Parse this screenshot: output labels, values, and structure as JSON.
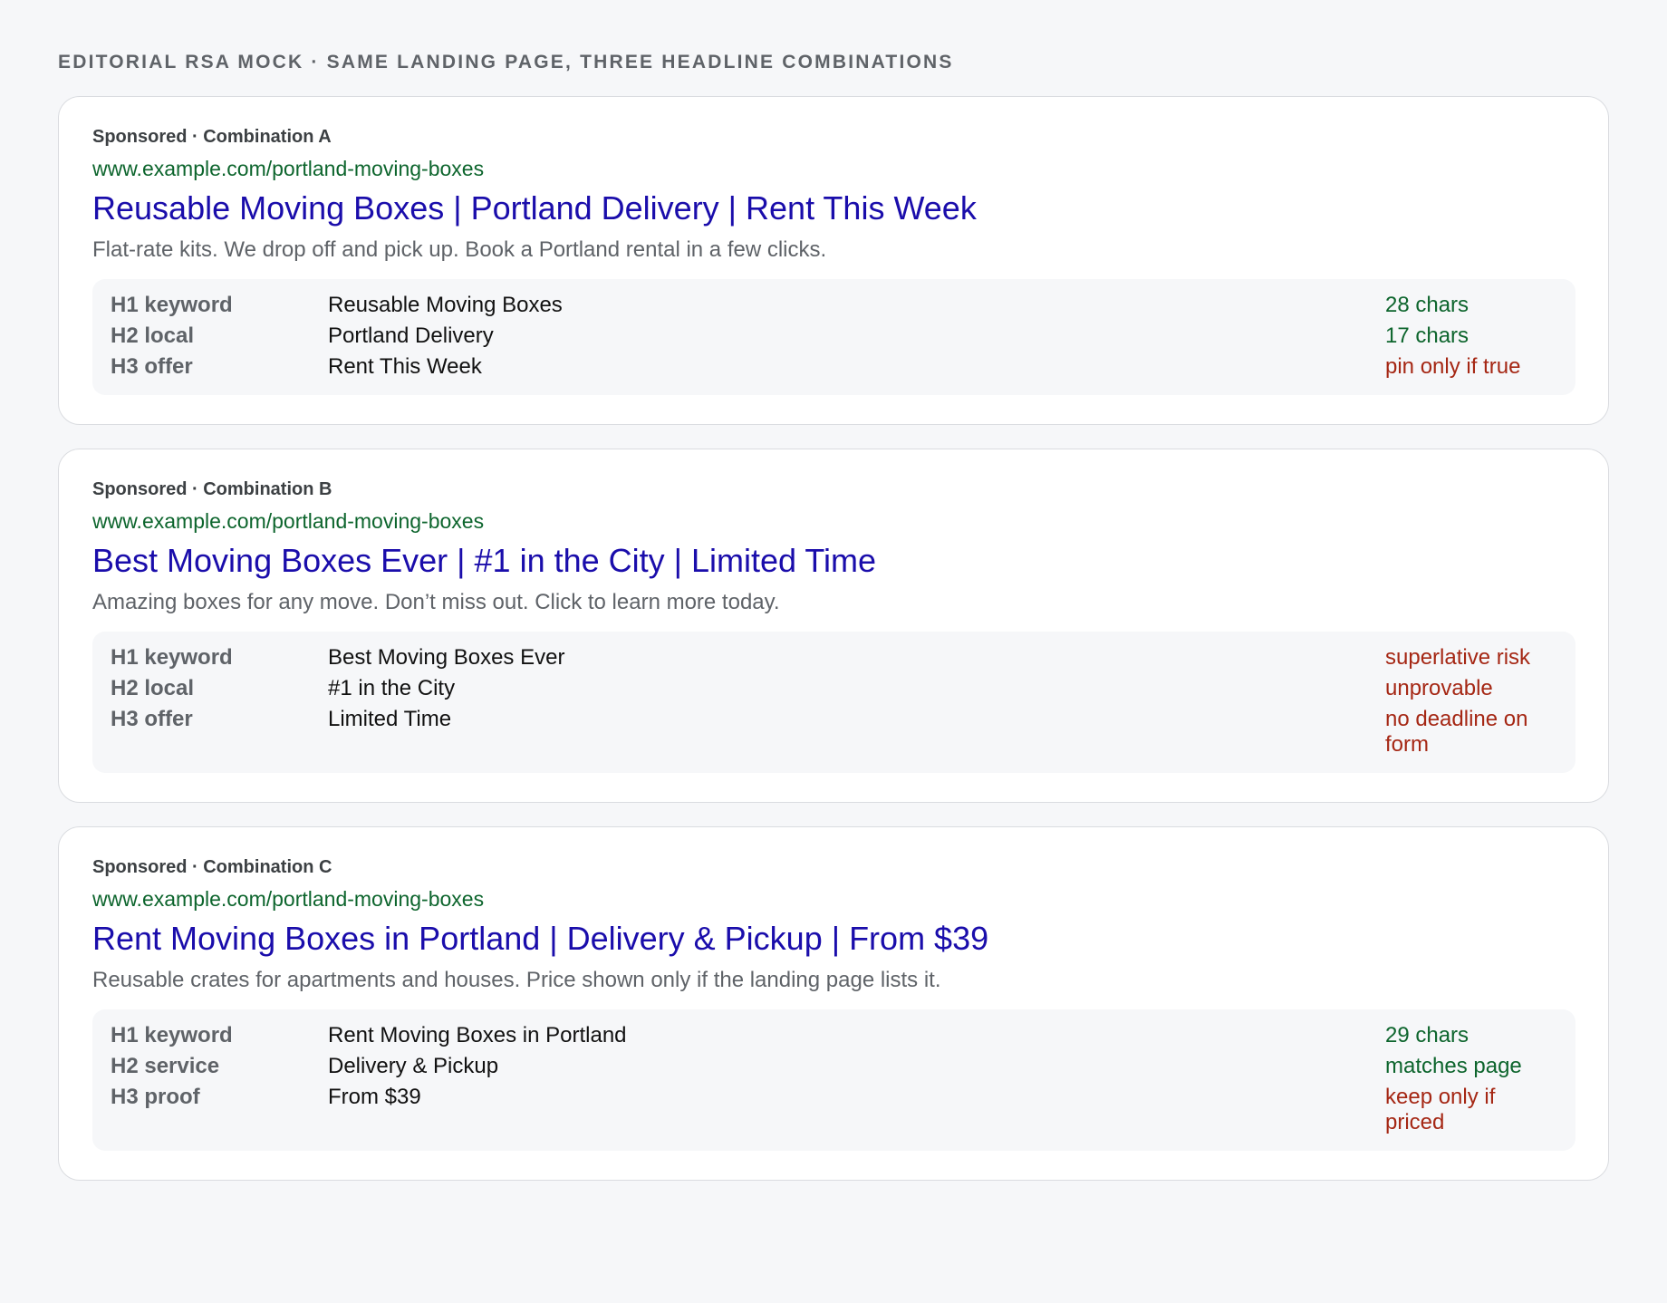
{
  "title": "EDITORIAL RSA MOCK · SAME LANDING PAGE, THREE HEADLINE COMBINATIONS",
  "colors": {
    "good": "#0d652d",
    "bad": "#a52714",
    "link": "#1a0dab",
    "url": "#0d652d"
  },
  "cards": [
    {
      "sponsored": "Sponsored · Combination A",
      "url": "www.example.com/portland-moving-boxes",
      "headline": "Reusable Moving Boxes | Portland Delivery | Rent This Week",
      "description": "Flat-rate kits. We drop off and pick up. Book a Portland rental in a few clicks.",
      "rows": [
        {
          "label": "H1 keyword",
          "value": "Reusable Moving Boxes",
          "note": "28 chars",
          "status": "good"
        },
        {
          "label": "H2 local",
          "value": "Portland Delivery",
          "note": "17 chars",
          "status": "good"
        },
        {
          "label": "H3 offer",
          "value": "Rent This Week",
          "note": "pin only if true",
          "status": "bad"
        }
      ]
    },
    {
      "sponsored": "Sponsored · Combination B",
      "url": "www.example.com/portland-moving-boxes",
      "headline": "Best Moving Boxes Ever | #1 in the City | Limited Time",
      "description": "Amazing boxes for any move. Don’t miss out. Click to learn more today.",
      "rows": [
        {
          "label": "H1 keyword",
          "value": "Best Moving Boxes Ever",
          "note": "superlative risk",
          "status": "bad"
        },
        {
          "label": "H2 local",
          "value": "#1 in the City",
          "note": "unprovable",
          "status": "bad"
        },
        {
          "label": "H3 offer",
          "value": "Limited Time",
          "note": "no deadline on form",
          "status": "bad"
        }
      ]
    },
    {
      "sponsored": "Sponsored · Combination C",
      "url": "www.example.com/portland-moving-boxes",
      "headline": "Rent Moving Boxes in Portland | Delivery & Pickup | From $39",
      "description": "Reusable crates for apartments and houses. Price shown only if the landing page lists it.",
      "rows": [
        {
          "label": "H1 keyword",
          "value": "Rent Moving Boxes in Portland",
          "note": "29 chars",
          "status": "good"
        },
        {
          "label": "H2 service",
          "value": "Delivery & Pickup",
          "note": "matches page",
          "status": "good"
        },
        {
          "label": "H3 proof",
          "value": "From $39",
          "note": "keep only if priced",
          "status": "bad"
        }
      ]
    }
  ]
}
